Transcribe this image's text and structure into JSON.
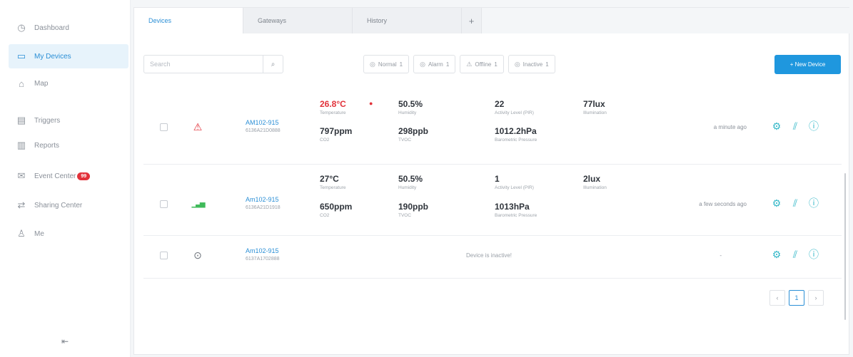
{
  "sidebar": {
    "items": [
      {
        "label": "Dashboard",
        "icon": "dashboard-icon",
        "glyph": "◷"
      },
      {
        "label": "My Devices",
        "icon": "devices-icon",
        "glyph": "▭"
      },
      {
        "label": "Map",
        "icon": "map-icon",
        "glyph": "⌂"
      },
      {
        "label": "Triggers",
        "icon": "triggers-icon",
        "glyph": "▤"
      },
      {
        "label": "Reports",
        "icon": "reports-icon",
        "glyph": "▥"
      },
      {
        "label": "Event Center",
        "icon": "event-center-icon",
        "glyph": "✉",
        "badge": "99"
      },
      {
        "label": "Sharing Center",
        "icon": "sharing-center-icon",
        "glyph": "⇄"
      },
      {
        "label": "Me",
        "icon": "user-icon",
        "glyph": "♙"
      }
    ],
    "collapse_glyph": "⇤"
  },
  "tabs": [
    {
      "label": "Devices"
    },
    {
      "label": "Gateways"
    },
    {
      "label": "History"
    }
  ],
  "tab_add": "+",
  "search": {
    "placeholder": "Search",
    "icon_glyph": "⌕"
  },
  "filters": [
    {
      "label": "Normal",
      "count": "1",
      "glyph": "◎"
    },
    {
      "label": "Alarm",
      "count": "1",
      "glyph": "◎"
    },
    {
      "label": "Offline",
      "count": "1",
      "glyph": "⚠"
    },
    {
      "label": "Inactive",
      "count": "1",
      "glyph": "◎"
    }
  ],
  "new_device_label": "+ New Device",
  "rows": [
    {
      "name": "AM102-915",
      "id": "6136A21D0888",
      "status_icon": "alarm-icon",
      "status_glyph": "⚠",
      "status_color": "#e2323a",
      "metrics": [
        {
          "value": "26.8°C",
          "label": "Temperature",
          "alert": true
        },
        {
          "value": "50.5%",
          "label": "Humidity"
        },
        {
          "value": "22",
          "label": "Activity Level (PIR)"
        },
        {
          "value": "77lux",
          "label": "Illumination"
        },
        {
          "value": "797ppm",
          "label": "CO2"
        },
        {
          "value": "298ppb",
          "label": "TVOC"
        },
        {
          "value": "1012.2hPa",
          "label": "Barometric Pressure"
        }
      ],
      "timestamp": "a minute ago"
    },
    {
      "name": "Am102-915",
      "id": "6136A21D1918",
      "status_icon": "signal-icon",
      "status_glyph": "▁▃▅",
      "status_color": "#3fba5a",
      "metrics": [
        {
          "value": "27°C",
          "label": "Temperature"
        },
        {
          "value": "50.5%",
          "label": "Humidity"
        },
        {
          "value": "1",
          "label": "Activity Level (PIR)"
        },
        {
          "value": "2lux",
          "label": "Illumination"
        },
        {
          "value": "650ppm",
          "label": "CO2"
        },
        {
          "value": "190ppb",
          "label": "TVOC"
        },
        {
          "value": "1013hPa",
          "label": "Barometric Pressure"
        }
      ],
      "timestamp": "a few seconds ago"
    },
    {
      "name": "Am102-915",
      "id": "6137A1702888",
      "status_icon": "inactive-icon",
      "status_glyph": "⊙",
      "status_color": "#8a9099",
      "inactive_message": "Device is inactive!",
      "timestamp": "-"
    }
  ],
  "action_icons": [
    "settings-icon",
    "chart-icon",
    "info-icon"
  ],
  "action_glyphs": [
    "⚙",
    "⫽",
    "ⓘ"
  ],
  "pagination": {
    "prev": "‹",
    "current": "1",
    "next": "›"
  },
  "colors": {
    "accent": "#1f97de",
    "alert": "#e2323a",
    "action": "#35b8c8"
  }
}
